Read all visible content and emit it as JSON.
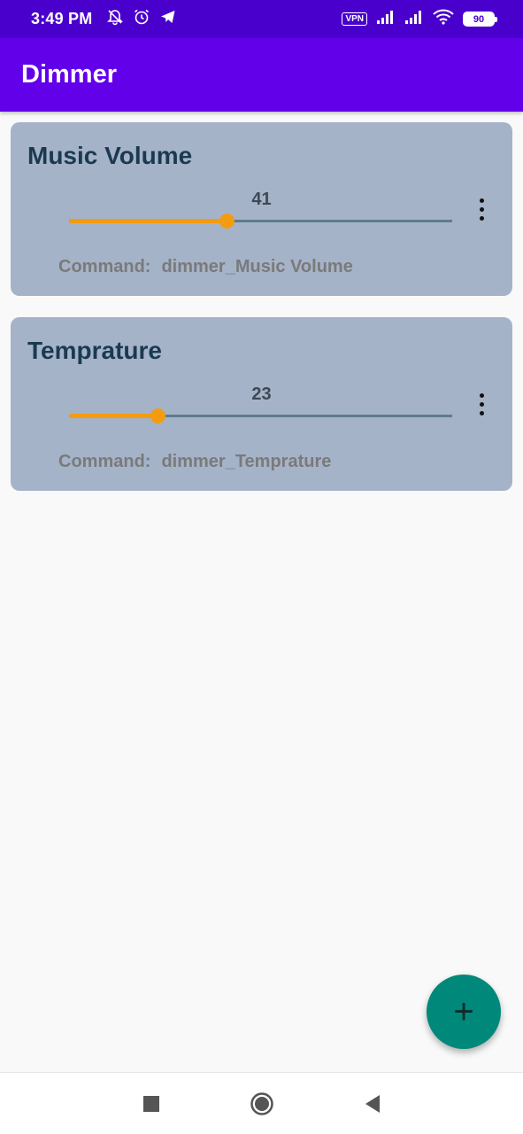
{
  "status_bar": {
    "time": "3:49 PM",
    "left_icons": [
      "bell-off-icon",
      "alarm-icon",
      "telegram-icon"
    ],
    "vpn_label": "VPN",
    "right_icons": [
      "signal-icon",
      "signal-icon",
      "wifi-icon"
    ],
    "battery": "90",
    "background": "#4a00cc"
  },
  "app_bar": {
    "title": "Dimmer",
    "background": "#6200ea"
  },
  "dimmers": [
    {
      "title": "Music Volume",
      "value": "41",
      "level_percent": 41,
      "command_label": "Command:",
      "command": "dimmer_Music Volume"
    },
    {
      "title": "Temprature",
      "value": "23",
      "level_percent": 23,
      "command_label": "Command:",
      "command": "dimmer_Temprature"
    }
  ],
  "fab": {
    "icon": "plus-icon",
    "symbol": "+",
    "color": "#00897b"
  },
  "nav_bar": {
    "icons": [
      "recents-square-icon",
      "home-circle-icon",
      "back-triangle-icon"
    ]
  },
  "colors": {
    "card_background": "#a5b3c9",
    "slider_active": "#f39c12",
    "slider_inactive": "#5e7d8c",
    "title_text": "#1b3a4f"
  }
}
